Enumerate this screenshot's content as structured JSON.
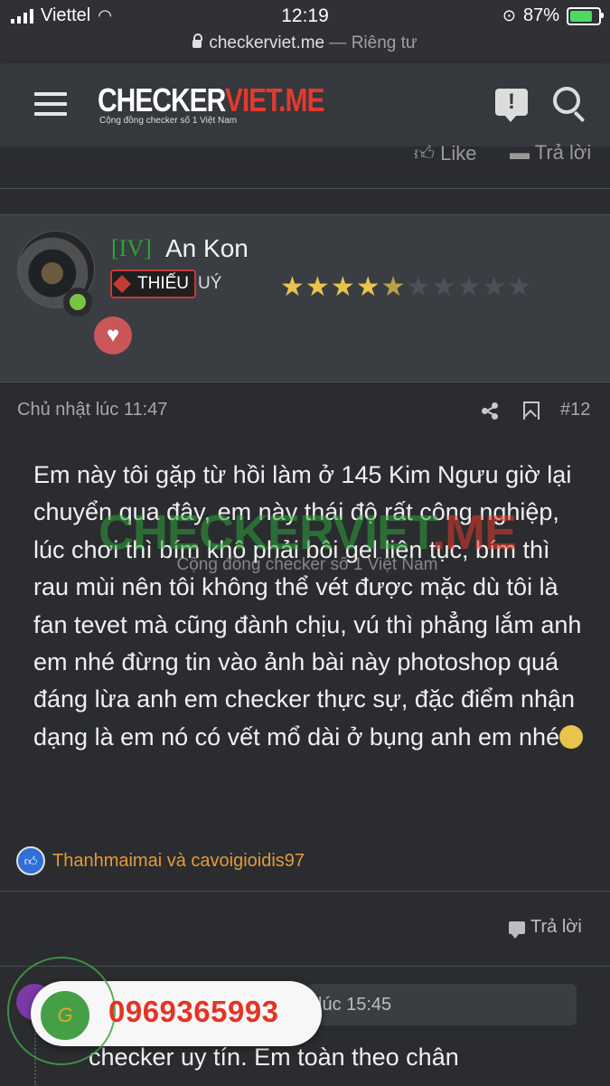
{
  "status_bar": {
    "carrier": "Viettel",
    "time": "12:19",
    "battery": "87%"
  },
  "browser": {
    "domain": "checkerviet.me",
    "separator": " — ",
    "privacy": "Riêng tư"
  },
  "nav": {
    "logo_main": "CHECKERVIET.ME",
    "logo_main_white": "CHECKER",
    "logo_main_red": "VIET.ME",
    "logo_tagline": "Cộng đồng checker số 1 Việt Nam"
  },
  "prev_post": {
    "like": "Like",
    "reply": "Trả lời"
  },
  "author": {
    "tag": "[IV]",
    "name": "An Kon",
    "rank_badge": "THIẾU",
    "rank_rest": "UÝ",
    "rating": 4.5,
    "rating_max": 10
  },
  "post": {
    "time": "Chủ nhật lúc 11:47",
    "number": "#12",
    "body": "Em này tôi gặp từ hồi làm ở 145 Kim Ngưu giờ lại chuyển qua đây, em này thái độ rất công nghiệp, lúc chơi thì bím khô phải bôi gel liên tục, bím thì rau mùi nên tôi không thể vét được mặc dù tôi là fan tevet mà cũng đành chịu, vú thì phẳng lắm anh em nhé đừng tin vào ảnh bài này photoshop quá đáng lừa anh em checker thực sự, đặc điểm nhận dạng là em nó có vết mổ dài ở bụng anh em nhé",
    "reactions": "Thanhmaimai và cavoigioidis97",
    "reply": "Trả lời"
  },
  "watermark": {
    "main_green": "CHECKERVIET",
    "main_red": ".ME",
    "sub": "Cộng đồng checker số 1 Việt Nam"
  },
  "next_post": {
    "time": "lúc 15:45",
    "text": "checker uy tín. Em toàn theo chân"
  },
  "floating": {
    "phone": "0969365993",
    "icon_letter": "G"
  },
  "colors": {
    "nav_bg": "#35383d",
    "page_bg": "#2a2c2f",
    "tag_green": "#2ea43a",
    "accent_red": "#e33a2f",
    "reaction_orange": "#e39a3a",
    "star_gold": "#e8c34e"
  }
}
